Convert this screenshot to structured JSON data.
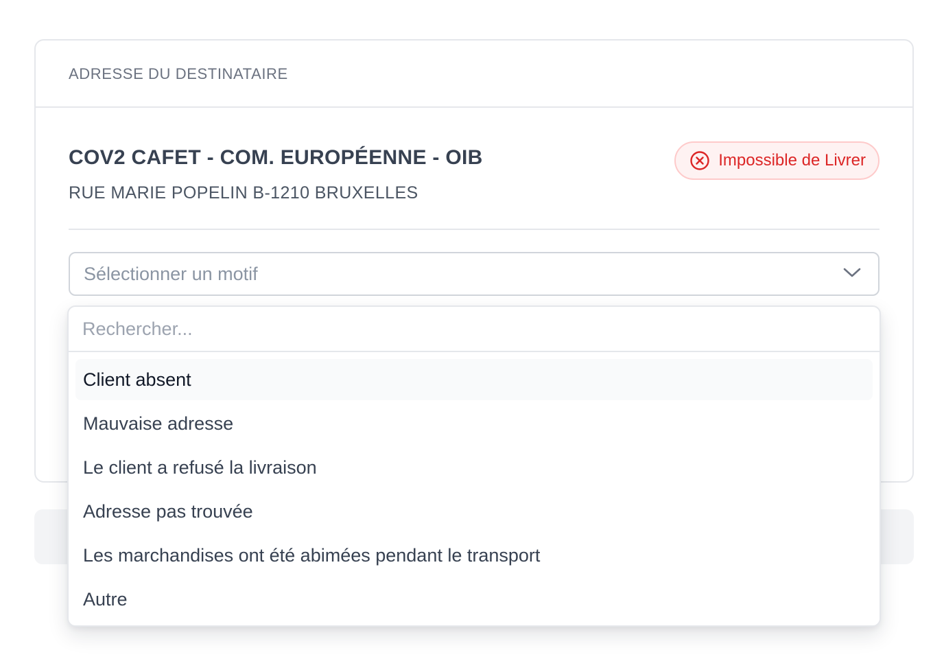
{
  "card": {
    "header_title": "ADRESSE DU DESTINATAIRE",
    "recipient_name": "COV2 CAFET - COM. EUROPÉENNE - OIB",
    "recipient_address": "RUE MARIE POPELIN B-1210 BRUXELLES",
    "status_badge": {
      "label": "Impossible de Livrer",
      "icon": "x-circle-icon",
      "color": "#dc2626"
    }
  },
  "reason_select": {
    "placeholder": "Sélectionner un motif",
    "icon": "chevron-down-icon"
  },
  "dropdown": {
    "search_placeholder": "Rechercher...",
    "search_value": "",
    "highlighted_index": 0,
    "options": [
      {
        "label": "Client absent"
      },
      {
        "label": "Mauvaise adresse"
      },
      {
        "label": "Le client a refusé la livraison"
      },
      {
        "label": "Adresse pas trouvée"
      },
      {
        "label": "Les marchandises ont été abimées pendant le transport"
      },
      {
        "label": "Autre"
      }
    ]
  }
}
